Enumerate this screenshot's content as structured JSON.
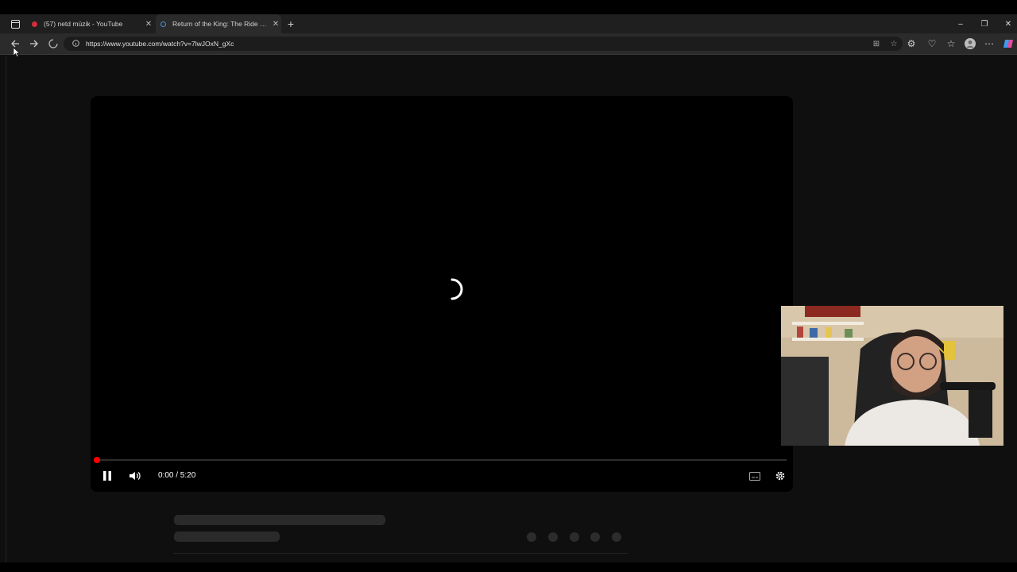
{
  "browser": {
    "tabs": [
      {
        "title": "(57) netd müzik - YouTube",
        "active": false,
        "favicon_color": "#d0303a"
      },
      {
        "title": "Return of the King: The Ride of th",
        "active": true,
        "favicon_color": "#4a8fd9"
      }
    ],
    "new_tab": "+",
    "window_controls": {
      "minimize": "–",
      "restore": "❐",
      "close": "✕"
    },
    "url": "https://www.youtube.com/watch?v=7lwJOxN_gXc"
  },
  "player": {
    "time_display": "0:00 / 5:20",
    "progress": 0.0,
    "state": "loading",
    "accent_color": "#ff0000"
  },
  "skeleton": {
    "placeholder_dot_count": 5
  }
}
